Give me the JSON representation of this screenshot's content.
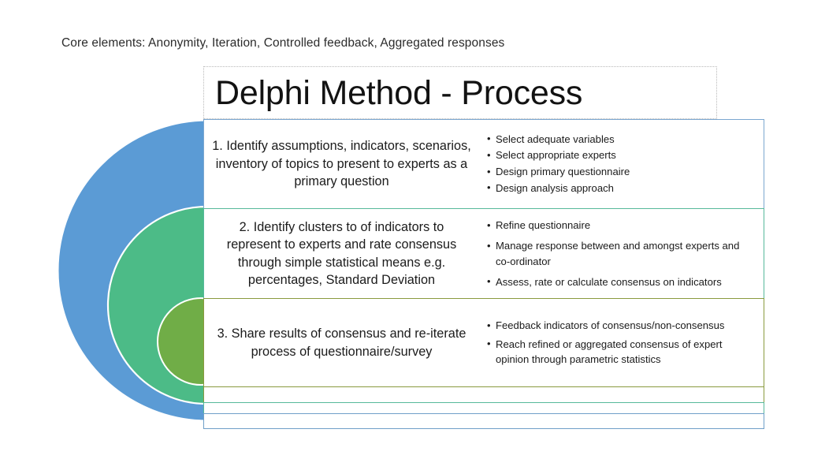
{
  "core_elements": "Core elements: Anonymity, Iteration, Controlled feedback, Aggregated responses",
  "title": "Delphi Method - Process",
  "circles": [
    {
      "name": "outer-circle",
      "color": "#5b9bd5",
      "label": ""
    },
    {
      "name": "middle-circle",
      "color": "#4cbb87",
      "label": ""
    },
    {
      "name": "inner-circle",
      "color": "#70ad47",
      "label": ""
    }
  ],
  "colors": {
    "blue": "#5b9bd5",
    "green": "#4cbb87",
    "olive": "#70ad47",
    "row1_border": "#7ba7d0",
    "row2_border": "#57b99a",
    "row3_border": "#8a9a3f"
  },
  "rows": [
    {
      "step": "1. Identify assumptions, indicators, scenarios, inventory of topics to present to experts as a primary question",
      "bullets": [
        "Select adequate variables",
        "Select appropriate experts",
        "Design primary questionnaire",
        "Design analysis approach"
      ]
    },
    {
      "step": "2. Identify clusters to of indicators to represent to experts and rate consensus through simple statistical means e.g. percentages, Standard Deviation",
      "bullets": [
        "Refine questionnaire",
        "Manage response between and amongst experts and co-ordinator",
        "Assess, rate or calculate consensus on indicators"
      ]
    },
    {
      "step": "3. Share results of consensus and re-iterate process of questionnaire/survey",
      "bullets": [
        "Feedback indicators of consensus/non-consensus",
        "Reach refined or aggregated consensus of expert opinion through parametric statistics"
      ]
    }
  ]
}
